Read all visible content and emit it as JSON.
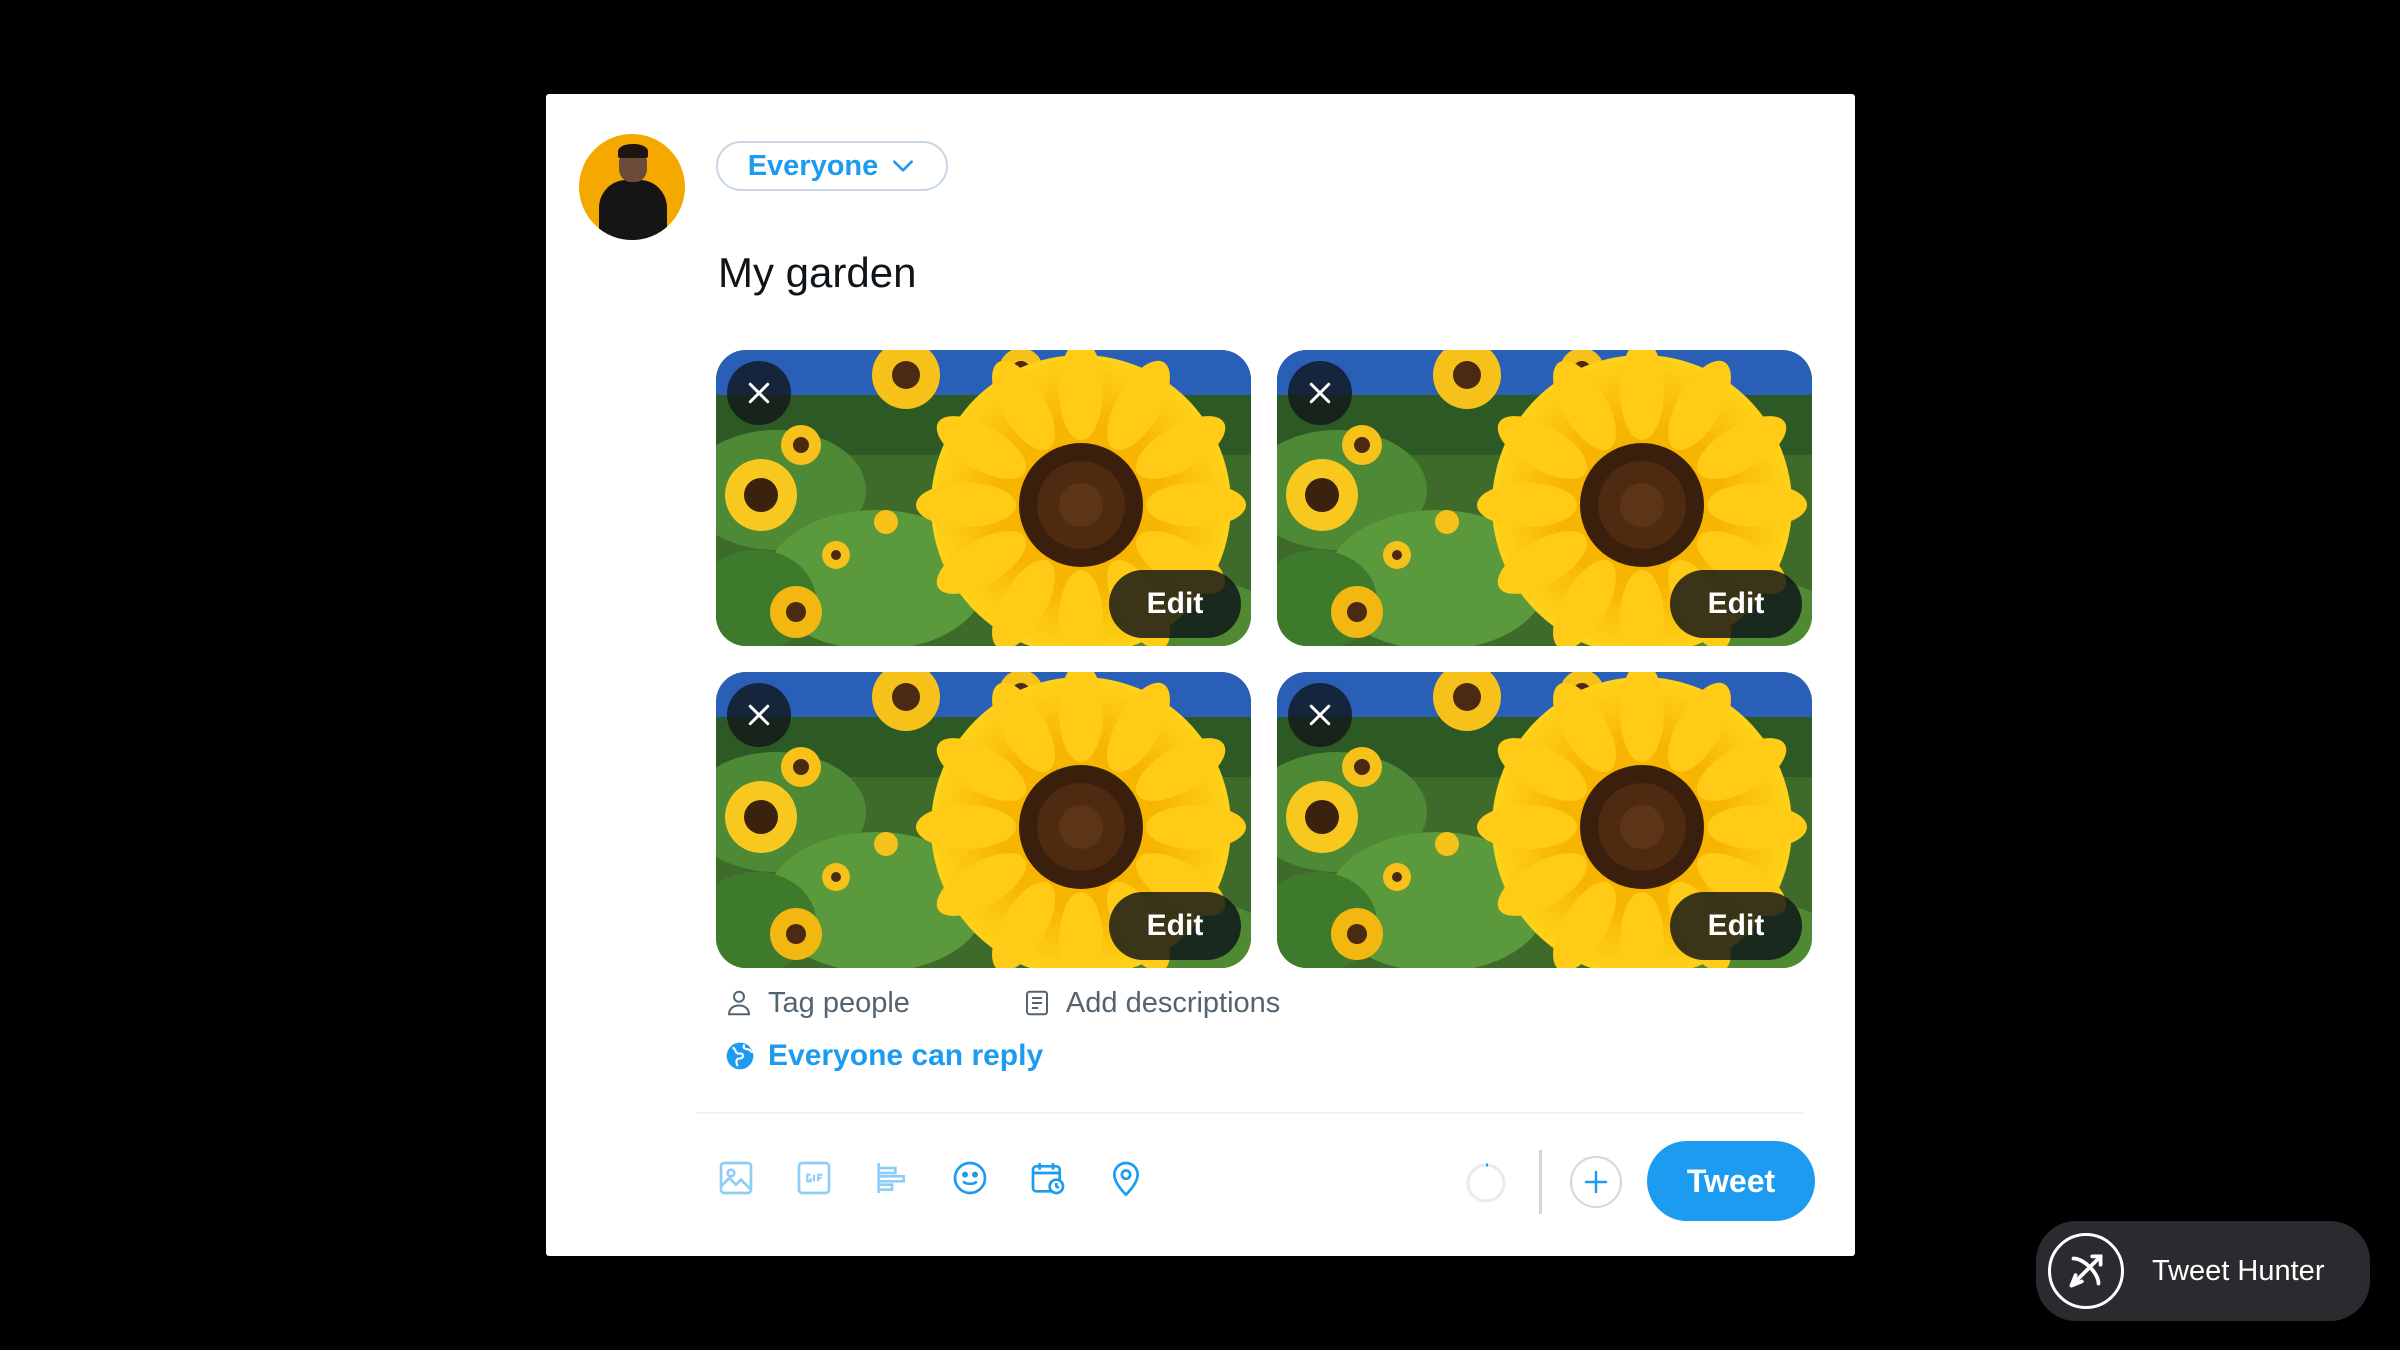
{
  "composer": {
    "audience_label": "Everyone",
    "tweet_text": "My garden",
    "media": [
      {
        "edit_label": "Edit"
      },
      {
        "edit_label": "Edit"
      },
      {
        "edit_label": "Edit"
      },
      {
        "edit_label": "Edit"
      }
    ],
    "tag_people_label": "Tag people",
    "add_descriptions_label": "Add descriptions",
    "reply_setting_label": "Everyone can reply",
    "toolbar_icons": [
      "media-icon",
      "gif-icon",
      "poll-icon",
      "emoji-icon",
      "schedule-icon",
      "location-icon"
    ],
    "tweet_button_label": "Tweet"
  },
  "badge": {
    "label": "Tweet Hunter"
  },
  "colors": {
    "accent": "#1d9bf0",
    "background": "#000000",
    "card": "#ffffff"
  }
}
